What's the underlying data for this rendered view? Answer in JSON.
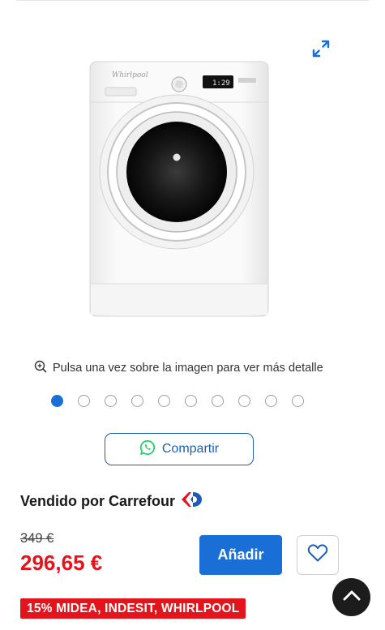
{
  "gallery": {
    "expand_icon": "expand-arrows-icon",
    "zoom_hint": "Pulsa una vez sobre la imagen para ver más detalle",
    "zoom_icon": "zoom-in-icon",
    "image_count": 10,
    "active_index": 0,
    "product_image": {
      "brand_text": "Whirlpool",
      "display_text": "1:29",
      "body_color": "#f7f7f7"
    }
  },
  "share": {
    "label": "Compartir",
    "icon": "whatsapp-icon",
    "icon_color": "#25d366"
  },
  "seller": {
    "text": "Vendido por Carrefour",
    "logo": "carrefour-logo"
  },
  "pricing": {
    "old_price": "349 €",
    "price": "296,65 €",
    "price_color": "#e3141b"
  },
  "actions": {
    "add_label": "Añadir",
    "add_color": "#1a6fd6",
    "wishlist_icon": "heart-icon",
    "scroll_top_icon": "chevron-up-icon"
  },
  "promo": {
    "label": "15% MIDEA, INDESIT, WHIRLPOOL",
    "color": "#e3141b"
  }
}
